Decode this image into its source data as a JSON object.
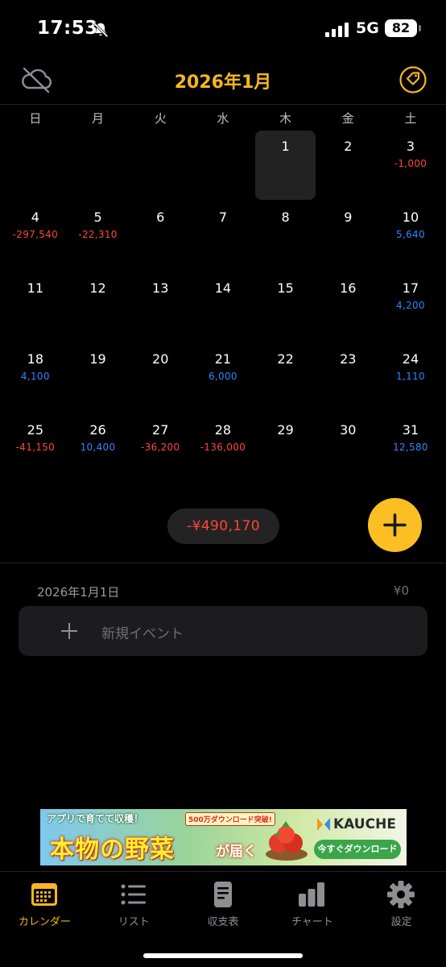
{
  "status_bar": {
    "time": "17:53",
    "network": "5G",
    "battery": "82"
  },
  "header": {
    "title": "2026年1月"
  },
  "weekdays": [
    "日",
    "月",
    "火",
    "水",
    "木",
    "金",
    "土"
  ],
  "calendar": {
    "weeks": [
      [
        {
          "day": "",
          "amount": ""
        },
        {
          "day": "",
          "amount": ""
        },
        {
          "day": "",
          "amount": ""
        },
        {
          "day": "",
          "amount": ""
        },
        {
          "day": "1",
          "amount": "",
          "selected": true
        },
        {
          "day": "2",
          "amount": ""
        },
        {
          "day": "3",
          "amount": "-1,000"
        }
      ],
      [
        {
          "day": "4",
          "amount": "-297,540"
        },
        {
          "day": "5",
          "amount": "-22,310"
        },
        {
          "day": "6",
          "amount": ""
        },
        {
          "day": "7",
          "amount": ""
        },
        {
          "day": "8",
          "amount": ""
        },
        {
          "day": "9",
          "amount": ""
        },
        {
          "day": "10",
          "amount": "5,640"
        }
      ],
      [
        {
          "day": "11",
          "amount": ""
        },
        {
          "day": "12",
          "amount": ""
        },
        {
          "day": "13",
          "amount": ""
        },
        {
          "day": "14",
          "amount": ""
        },
        {
          "day": "15",
          "amount": ""
        },
        {
          "day": "16",
          "amount": ""
        },
        {
          "day": "17",
          "amount": "4,200"
        }
      ],
      [
        {
          "day": "18",
          "amount": "4,100"
        },
        {
          "day": "19",
          "amount": ""
        },
        {
          "day": "20",
          "amount": ""
        },
        {
          "day": "21",
          "amount": "6,000"
        },
        {
          "day": "22",
          "amount": ""
        },
        {
          "day": "23",
          "amount": ""
        },
        {
          "day": "24",
          "amount": "1,110"
        }
      ],
      [
        {
          "day": "25",
          "amount": "-41,150"
        },
        {
          "day": "26",
          "amount": "10,400"
        },
        {
          "day": "27",
          "amount": "-36,200"
        },
        {
          "day": "28",
          "amount": "-136,000"
        },
        {
          "day": "29",
          "amount": ""
        },
        {
          "day": "30",
          "amount": ""
        },
        {
          "day": "31",
          "amount": "12,580"
        }
      ]
    ]
  },
  "summary": {
    "total": "-¥490,170"
  },
  "detail": {
    "date": "2026年1月1日",
    "total": "¥0",
    "new_event_label": "新規イベント"
  },
  "ad": {
    "top_text": "アプリで育てて収穫！",
    "badge": "500万ダウンロード突破!",
    "headline": "本物の野菜",
    "subline": "が届く",
    "brand": "KAUCHE",
    "cta": "今すぐダウンロード"
  },
  "tabs": [
    {
      "label": "カレンダー",
      "icon": "calendar-icon",
      "active": true
    },
    {
      "label": "リスト",
      "icon": "list-icon",
      "active": false
    },
    {
      "label": "収支表",
      "icon": "document-icon",
      "active": false
    },
    {
      "label": "チャート",
      "icon": "bar-chart-icon",
      "active": false
    },
    {
      "label": "設定",
      "icon": "gear-icon",
      "active": false
    }
  ],
  "colors": {
    "accent": "#f6b71f",
    "negative": "#ff453a",
    "positive": "#2f86ff",
    "background": "#000000"
  }
}
